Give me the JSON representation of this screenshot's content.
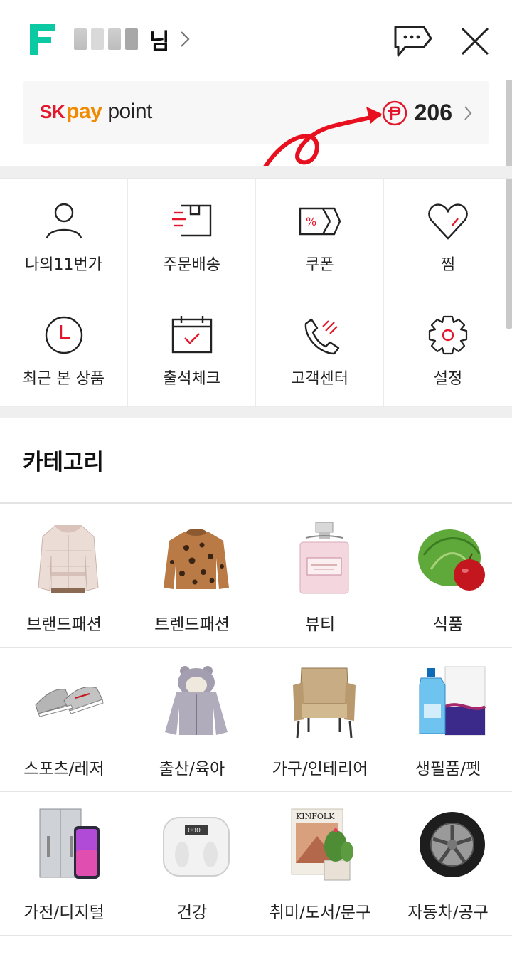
{
  "header": {
    "user_suffix": "님",
    "logo_letter": "F",
    "icons": [
      "chat-icon",
      "close-icon"
    ]
  },
  "paypoint": {
    "brand_sk": "SK",
    "brand_pay": "pay",
    "brand_point": "point",
    "value": "206",
    "colors": {
      "sk": "#e3172b",
      "pay": "#f08a00",
      "point_icon": "#e3172b"
    }
  },
  "menu": [
    {
      "label": "나의11번가",
      "icon": "person-icon"
    },
    {
      "label": "주문배송",
      "icon": "delivery-box-icon"
    },
    {
      "label": "쿠폰",
      "icon": "coupon-icon"
    },
    {
      "label": "찜",
      "icon": "heart-icon"
    },
    {
      "label": "최근 본 상품",
      "icon": "clock-icon"
    },
    {
      "label": "출석체크",
      "icon": "calendar-check-icon"
    },
    {
      "label": "고객센터",
      "icon": "phone-icon"
    },
    {
      "label": "설정",
      "icon": "gear-icon"
    }
  ],
  "category": {
    "title": "카테고리",
    "items": [
      {
        "label": "브랜드패션",
        "image": "puffer-jacket"
      },
      {
        "label": "트렌드패션",
        "image": "leopard-sweater"
      },
      {
        "label": "뷰티",
        "image": "perfume-bottle"
      },
      {
        "label": "식품",
        "image": "cabbage-apple"
      },
      {
        "label": "스포츠/레저",
        "image": "sneakers"
      },
      {
        "label": "출산/육아",
        "image": "baby-jacket"
      },
      {
        "label": "가구/인테리어",
        "image": "armchair"
      },
      {
        "label": "생필품/펫",
        "image": "detergent-tissue"
      },
      {
        "label": "가전/디지털",
        "image": "fridge-phone"
      },
      {
        "label": "건강",
        "image": "body-scale"
      },
      {
        "label": "취미/도서/문구",
        "image": "book-cactus"
      },
      {
        "label": "자동차/공구",
        "image": "tire"
      }
    ],
    "book_title": "KINFOLK"
  },
  "accent_color": "#e3172b"
}
